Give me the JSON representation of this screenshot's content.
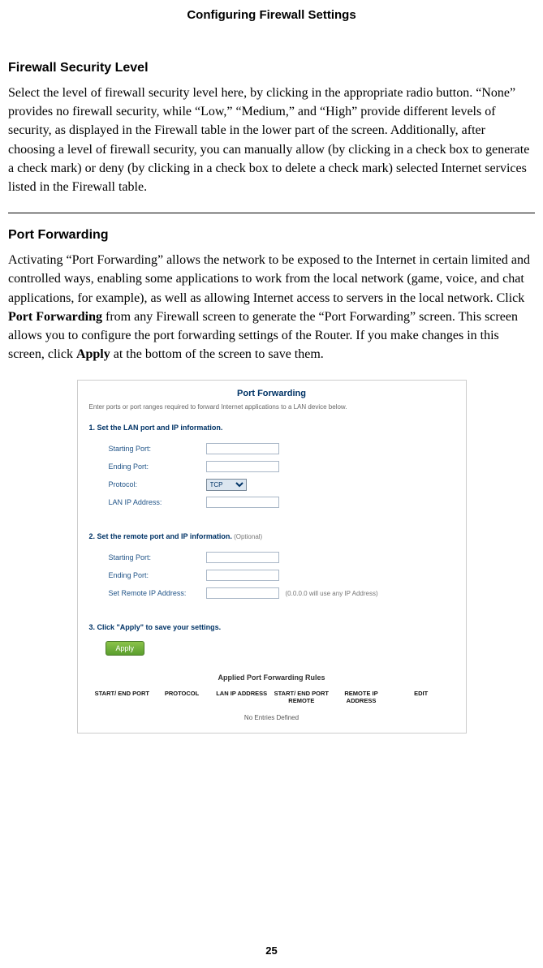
{
  "page": {
    "header": "Configuring Firewall Settings",
    "number": "25"
  },
  "section1": {
    "title": "Firewall Security Level",
    "body": "Select the level of firewall security level here, by clicking in the appropriate radio button. “None” provides no firewall security, while “Low,” “Medium,” and “High” provide different levels of security, as displayed in the Firewall table in the lower part of the screen. Additionally, after choosing a level of firewall security, you can manually allow (by clicking in a check box to generate a check mark) or deny (by clicking in a check box to delete a check mark) selected Internet services listed in the Firewall table."
  },
  "section2": {
    "title": "Port Forwarding",
    "body_p1": "Activating “Port Forwarding” allows the network to be exposed to the Internet in certain limited and controlled ways, enabling some applications to work from the local network (game, voice, and chat applications, for example), as well as allowing Internet access to servers in the local network. Click ",
    "body_b1": "Port Forwarding",
    "body_p2": " from any Firewall screen to generate the “Port Forwarding” screen. This screen allows you to configure the port forwarding settings of the Router. If you make changes in this screen, click ",
    "body_b2": "Apply",
    "body_p3": " at the bottom of the screen to save them."
  },
  "screenshot": {
    "title": "Port Forwarding",
    "subtitle": "Enter ports or port ranges required to forward Internet applications to a LAN device below.",
    "step1": {
      "title": "1. Set the LAN port and IP information.",
      "starting_port_label": "Starting Port:",
      "starting_port_value": "",
      "ending_port_label": "Ending Port:",
      "ending_port_value": "",
      "protocol_label": "Protocol:",
      "protocol_value": "TCP",
      "lan_ip_label": "LAN IP Address:",
      "lan_ip_value": ""
    },
    "step2": {
      "title": "2. Set the remote port and IP information.",
      "optional": " (Optional)",
      "starting_port_label": "Starting Port:",
      "starting_port_value": "",
      "ending_port_label": "Ending Port:",
      "ending_port_value": "",
      "remote_ip_label": "Set Remote IP Address:",
      "remote_ip_value": "",
      "remote_ip_hint": "(0.0.0.0 will use any IP Address)"
    },
    "step3": {
      "title": "3. Click \"Apply\" to save your settings.",
      "apply_label": "Apply"
    },
    "rules": {
      "title": "Applied Port Forwarding Rules",
      "col1": "START/ END PORT",
      "col2": "PROTOCOL",
      "col3": "LAN IP ADDRESS",
      "col4": "START/ END PORT REMOTE",
      "col5": "REMOTE IP ADDRESS",
      "col6": "EDIT",
      "empty": "No Entries Defined"
    }
  }
}
